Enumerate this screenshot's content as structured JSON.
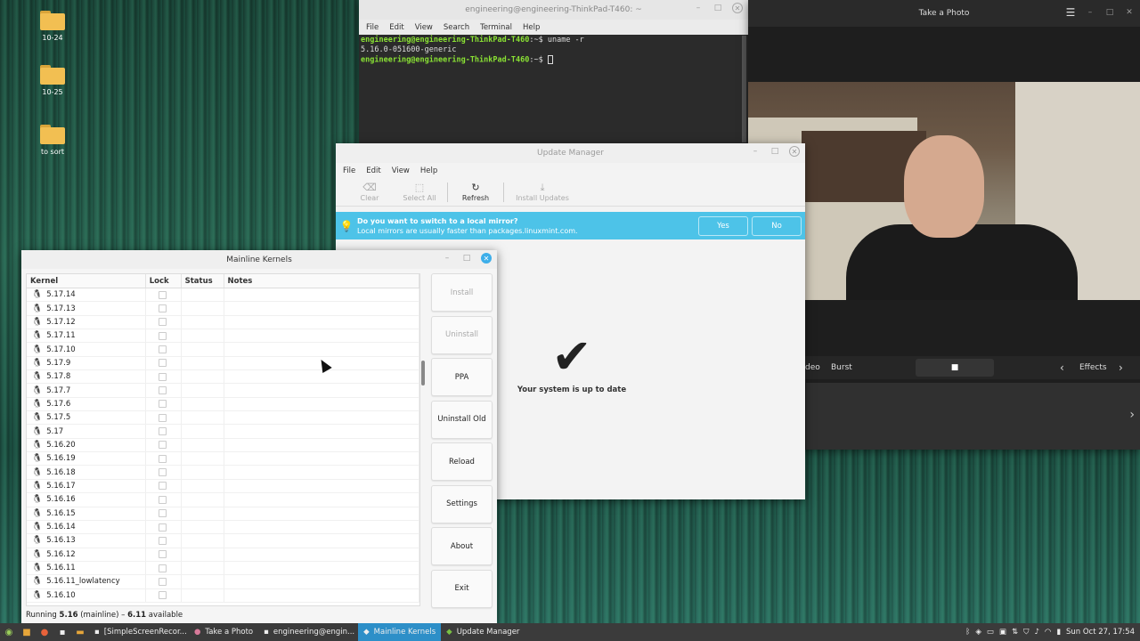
{
  "desktop": {
    "icons": [
      {
        "label": "10-24"
      },
      {
        "label": "10-25"
      },
      {
        "label": "to sort"
      }
    ]
  },
  "terminal": {
    "title": "engineering@engineering-ThinkPad-T460: ~",
    "menu": [
      "File",
      "Edit",
      "View",
      "Search",
      "Terminal",
      "Help"
    ],
    "lines": [
      {
        "prompt": "engineering@engineering-ThinkPad-T460",
        "suffix": ":~$ ",
        "cmd": "uname -r"
      },
      {
        "output": "5.16.0-051600-generic"
      },
      {
        "prompt": "engineering@engineering-ThinkPad-T460",
        "suffix": ":~$ ",
        "cmd": ""
      }
    ]
  },
  "camera": {
    "title": "Take a Photo",
    "modes": [
      "deo",
      "Burst"
    ],
    "effects_label": "Effects"
  },
  "update_manager": {
    "title": "Update Manager",
    "menu": [
      "File",
      "Edit",
      "View",
      "Help"
    ],
    "toolbar": {
      "clear": "Clear",
      "select_all": "Select All",
      "refresh": "Refresh",
      "install_updates": "Install Updates"
    },
    "infobar": {
      "heading": "Do you want to switch to a local mirror?",
      "body": "Local mirrors are usually faster than packages.linuxmint.com.",
      "yes": "Yes",
      "no": "No"
    },
    "status": "Your system is up to date"
  },
  "mainline": {
    "title": "Mainline Kernels",
    "columns": {
      "kernel": "Kernel",
      "lock": "Lock",
      "status": "Status",
      "notes": "Notes"
    },
    "kernels": [
      "5.17.14",
      "5.17.13",
      "5.17.12",
      "5.17.11",
      "5.17.10",
      "5.17.9",
      "5.17.8",
      "5.17.7",
      "5.17.6",
      "5.17.5",
      "5.17",
      "5.16.20",
      "5.16.19",
      "5.16.18",
      "5.16.17",
      "5.16.16",
      "5.16.15",
      "5.16.14",
      "5.16.13",
      "5.16.12",
      "5.16.11",
      "5.16.11_lowlatency",
      "5.16.10"
    ],
    "buttons": {
      "install": "Install",
      "uninstall": "Uninstall",
      "ppa": "PPA",
      "uninstall_old": "Uninstall Old",
      "reload": "Reload",
      "settings": "Settings",
      "about": "About",
      "exit": "Exit"
    },
    "status_prefix": "Running ",
    "status_running": "5.16",
    "status_suffix": " (mainline) – ",
    "status_available": "6.11",
    "status_tail": " available"
  },
  "taskbar": {
    "tasks": [
      {
        "label": "[SimpleScreenRecor..."
      },
      {
        "label": "Take a Photo"
      },
      {
        "label": "engineering@engin..."
      },
      {
        "label": "Mainline Kernels"
      },
      {
        "label": "Update Manager"
      }
    ],
    "clock": "Sun Oct 27, 17:54"
  }
}
